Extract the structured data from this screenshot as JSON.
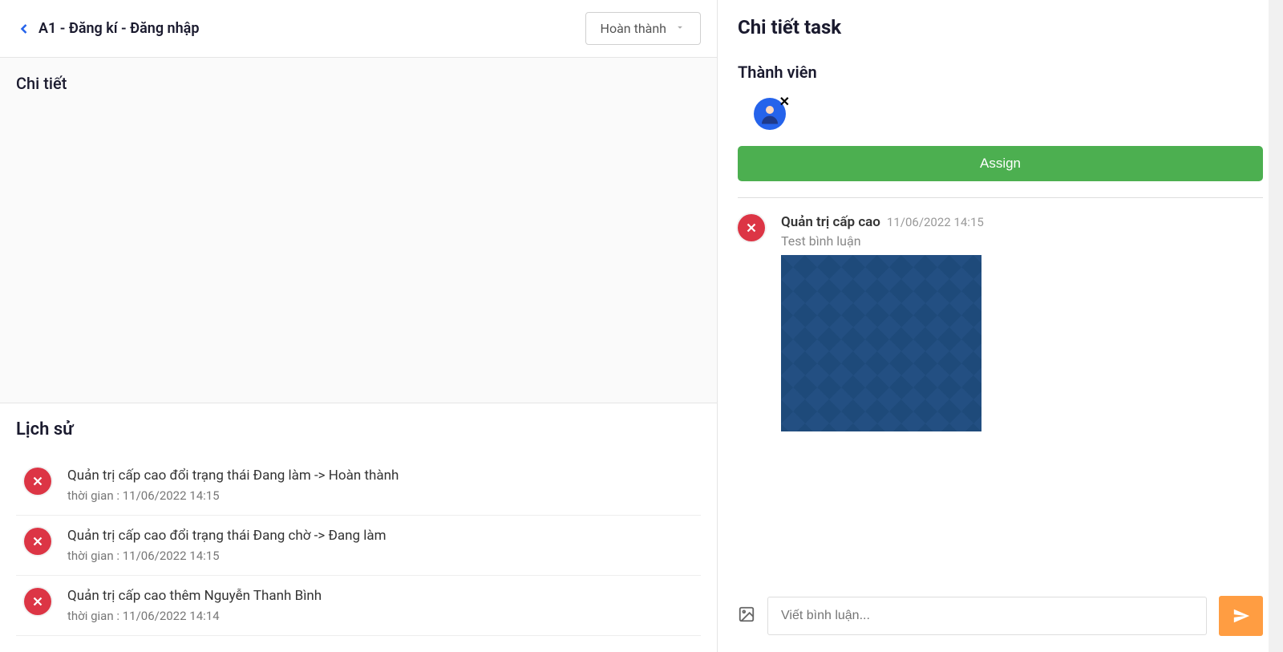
{
  "header": {
    "task_title": "A1 - Đăng kí - Đăng nhập",
    "status_selected": "Hoàn thành"
  },
  "detail": {
    "heading": "Chi tiết"
  },
  "history": {
    "heading": "Lịch sử",
    "time_label": "thời gian :",
    "items": [
      {
        "desc": "Quản trị cấp cao đổi trạng thái Đang làm -> Hoàn thành",
        "time": "11/06/2022 14:15"
      },
      {
        "desc": "Quản trị cấp cao đổi trạng thái Đang chờ -> Đang làm",
        "time": "11/06/2022 14:15"
      },
      {
        "desc": "Quản trị cấp cao thêm Nguyễn Thanh Bình",
        "time": "11/06/2022 14:14"
      }
    ]
  },
  "right": {
    "title": "Chi tiết task",
    "members_heading": "Thành viên",
    "assign_label": "Assign",
    "comment": {
      "author": "Quản trị cấp cao",
      "date": "11/06/2022 14:15",
      "text": "Test bình luận"
    },
    "input_placeholder": "Viết bình luận..."
  }
}
